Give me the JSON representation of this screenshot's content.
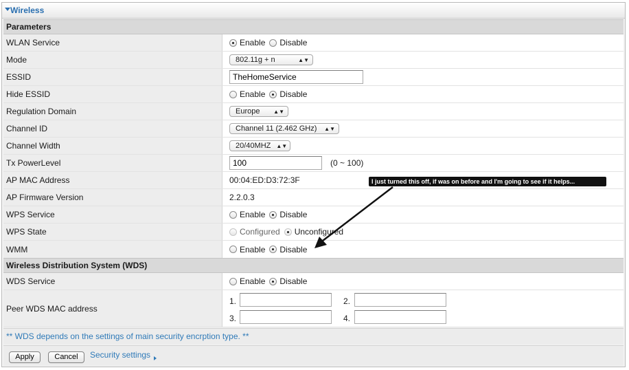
{
  "window": {
    "title": "Wireless"
  },
  "sections": {
    "parameters": "Parameters",
    "wds": "Wireless Distribution System (WDS)"
  },
  "rows": {
    "wlan_service": {
      "label": "WLAN Service",
      "opt1": "Enable",
      "opt2": "Disable",
      "selected": "Enable"
    },
    "mode": {
      "label": "Mode",
      "value": "802.11g + n"
    },
    "essid": {
      "label": "ESSID",
      "value": "TheHomeService"
    },
    "hide_essid": {
      "label": "Hide ESSID",
      "opt1": "Enable",
      "opt2": "Disable",
      "selected": "Disable"
    },
    "regulation_domain": {
      "label": "Regulation Domain",
      "value": "Europe"
    },
    "channel_id": {
      "label": "Channel ID",
      "value": "Channel 11 (2.462 GHz)"
    },
    "channel_width": {
      "label": "Channel Width",
      "value": "20/40MHZ"
    },
    "tx_power": {
      "label": "Tx PowerLevel",
      "value": "100",
      "range": "(0 ~ 100)"
    },
    "ap_mac": {
      "label": "AP MAC Address",
      "value": "00:04:ED:D3:72:3F"
    },
    "ap_firmware": {
      "label": "AP Firmware Version",
      "value": "2.2.0.3"
    },
    "wps_service": {
      "label": "WPS Service",
      "opt1": "Enable",
      "opt2": "Disable",
      "selected": "Disable"
    },
    "wps_state": {
      "label": "WPS State",
      "opt1": "Configured",
      "opt2": "Unconfigured",
      "selected": "Unconfigured"
    },
    "wmm": {
      "label": "WMM",
      "opt1": "Enable",
      "opt2": "Disable",
      "selected": "Disable"
    },
    "wds_service": {
      "label": "WDS Service",
      "opt1": "Enable",
      "opt2": "Disable",
      "selected": "Disable"
    },
    "peer_wds": {
      "label": "Peer WDS MAC address",
      "n1": "1.",
      "n2": "2.",
      "n3": "3.",
      "n4": "4."
    }
  },
  "footer": {
    "note": "** WDS depends on the settings of main security encrption type. **",
    "apply": "Apply",
    "cancel": "Cancel",
    "security_link": "Security settings"
  },
  "annotation": {
    "text": "I just turned this off, if was on before and I'm going to see if it helps..."
  },
  "colors": {
    "link": "#2f7ab8",
    "title": "#2a6fb0"
  },
  "icons": {
    "title_expand": "triangle-down-icon",
    "select_arrows": "updown-arrow-icon",
    "link_arrow": "triangle-right-icon"
  }
}
